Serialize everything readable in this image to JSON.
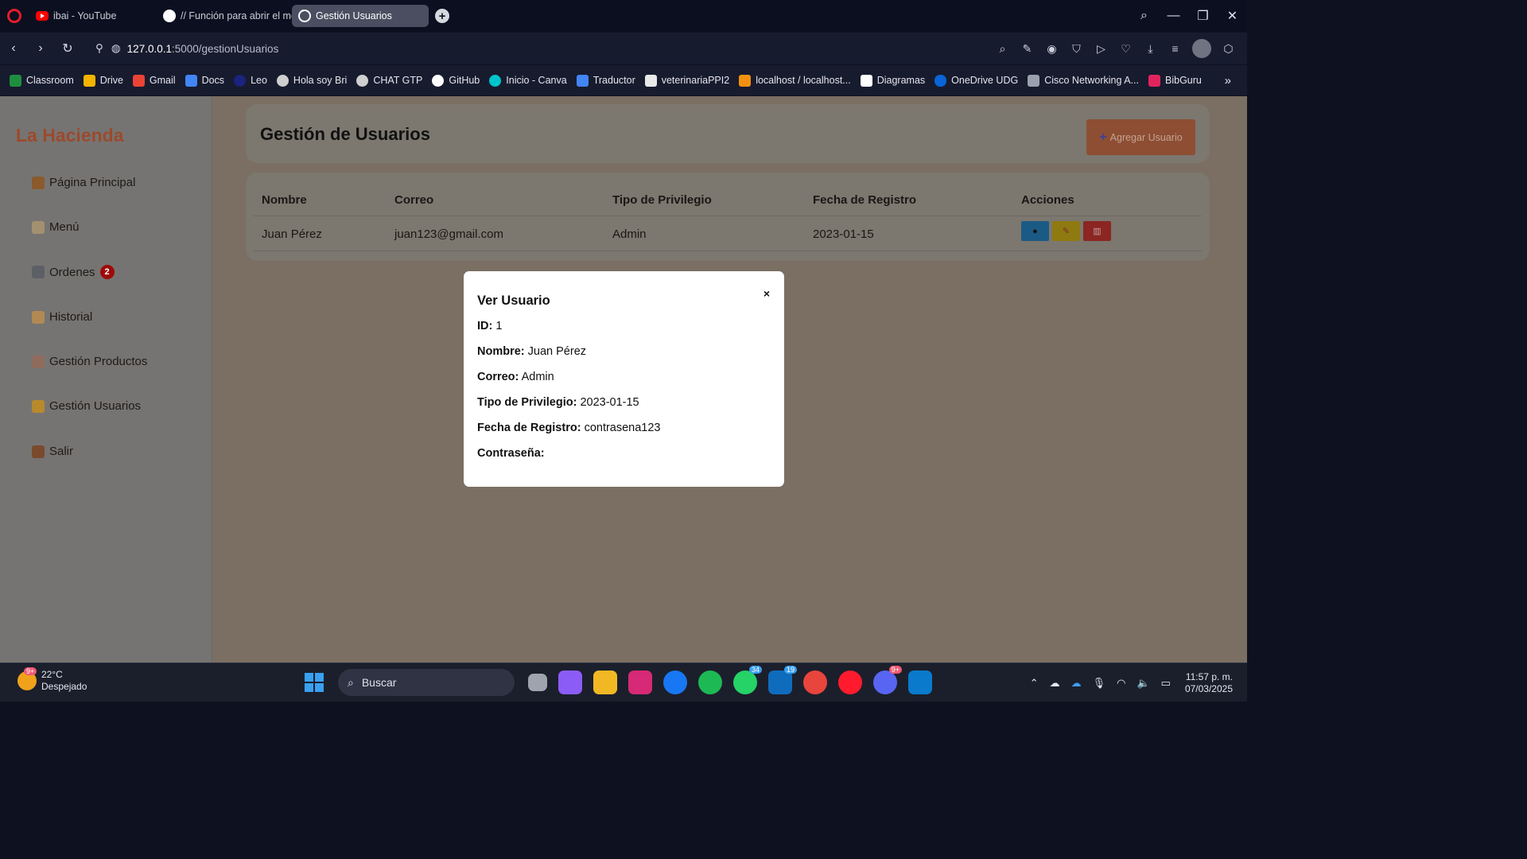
{
  "browser": {
    "tabs": [
      {
        "label": "ibai - YouTube"
      },
      {
        "label": "// Función para abrir el mo"
      },
      {
        "label": "Gestión Usuarios"
      }
    ],
    "url_host": "127.0.0.1",
    "url_path": ":5000/gestionUsuarios",
    "bookmarks": [
      "Classroom",
      "Drive",
      "Gmail",
      "Docs",
      "Leo",
      "Hola soy Bri",
      "CHAT GTP",
      "GitHub",
      "Inicio - Canva",
      "Traductor",
      "veterinariaPPI2",
      "localhost / localhost...",
      "Diagramas",
      "OneDrive UDG",
      "Cisco Networking A...",
      "BibGuru"
    ],
    "bookmark_more": "»"
  },
  "app": {
    "brand": "La Hacienda",
    "sidebar": [
      {
        "label": "Página Principal",
        "icon": "house-icon",
        "color": "#8a5a2c"
      },
      {
        "label": "Menú",
        "icon": "clipboard-icon",
        "color": "#a39070"
      },
      {
        "label": "Ordenes",
        "icon": "cart-icon",
        "color": "#5c5f66",
        "badge": "2"
      },
      {
        "label": "Historial",
        "icon": "scroll-icon",
        "color": "#b08a52"
      },
      {
        "label": "Gestión Productos",
        "icon": "pencil-paper-icon",
        "color": "#8f6b5c"
      },
      {
        "label": "Gestión Usuarios",
        "icon": "handshake-icon",
        "color": "#b88a2c"
      },
      {
        "label": "Salir",
        "icon": "door-icon",
        "color": "#7a4a2c"
      }
    ],
    "page_title": "Gestión de Usuarios",
    "add_button": "Agregar Usuario",
    "table": {
      "headers": [
        "Nombre",
        "Correo",
        "Tipo de Privilegio",
        "Fecha de Registro",
        "Acciones"
      ],
      "rows": [
        {
          "nombre": "Juan Pérez",
          "correo": "juan123@gmail.com",
          "privilegio": "Admin",
          "fecha": "2023-01-15"
        }
      ],
      "action_icons": [
        "eye-icon",
        "pencil-icon",
        "trash-icon"
      ]
    }
  },
  "modal": {
    "title": "Ver Usuario",
    "close": "×",
    "fields": [
      {
        "label": "ID:",
        "value": "1"
      },
      {
        "label": "Nombre:",
        "value": "Juan Pérez"
      },
      {
        "label": "Correo:",
        "value": "Admin"
      },
      {
        "label": "Tipo de Privilegio:",
        "value": "2023-01-15"
      },
      {
        "label": "Fecha de Registro:",
        "value": "contrasena123"
      },
      {
        "label": "Contraseña:",
        "value": ""
      }
    ]
  },
  "taskbar": {
    "weather_temp": "22°C",
    "weather_desc": "Despejado",
    "weather_badge": "9+",
    "search_placeholder": "Buscar",
    "whatsapp_badge": "34",
    "outlook_badge": "19",
    "discord_badge": "9+",
    "time": "11:57 p. m.",
    "date": "07/03/2025"
  },
  "colors": {
    "brand": "#9b4a2d",
    "view_button": "#1b5a84",
    "edit_button": "#8f7a11",
    "delete_button": "#8b2622",
    "overlay": "#7a6f62"
  }
}
